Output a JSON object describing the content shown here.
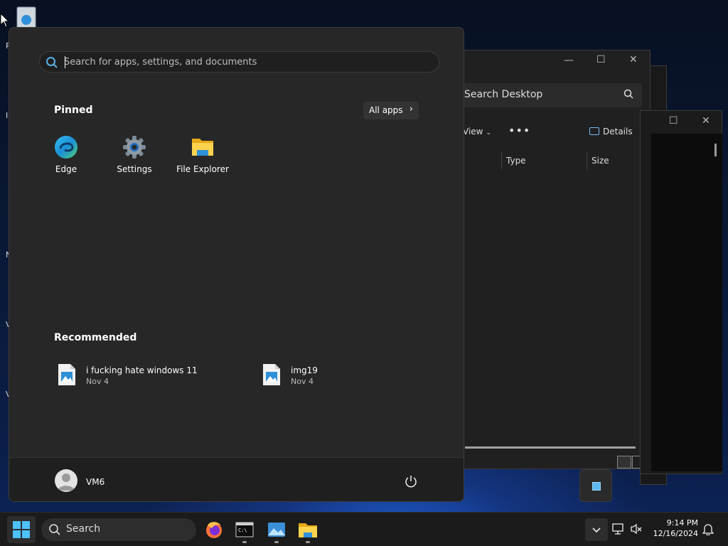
{
  "start_menu": {
    "search_placeholder": "Search for apps, settings, and documents",
    "pinned_title": "Pinned",
    "all_apps_label": "All apps",
    "pinned": [
      {
        "label": "Edge",
        "icon": "edge-icon"
      },
      {
        "label": "Settings",
        "icon": "gear-icon"
      },
      {
        "label": "File Explorer",
        "icon": "folder-icon"
      }
    ],
    "recommended_title": "Recommended",
    "recommended": [
      {
        "name": "i fucking hate windows 11",
        "date": "Nov 4",
        "icon": "image-file-icon"
      },
      {
        "name": "img19",
        "date": "Nov 4",
        "icon": "image-file-icon"
      }
    ],
    "user_name": "VM6"
  },
  "explorer": {
    "search_placeholder": "Search Desktop",
    "view_label": "View",
    "details_label": "Details",
    "columns": [
      "Type",
      "Size"
    ]
  },
  "desktop_clipped_labels": [
    "R",
    "I",
    "N",
    "V",
    "V"
  ],
  "taskbar": {
    "search_label": "Search",
    "time": "9:14 PM",
    "date": "12/16/2024",
    "apps": [
      "firefox-icon",
      "terminal-icon",
      "photos-icon",
      "file-explorer-icon"
    ]
  },
  "colors": {
    "start_bg": "#272727",
    "accent_blue": "#0078d4",
    "taskbar_bg": "#1b1b1b"
  }
}
